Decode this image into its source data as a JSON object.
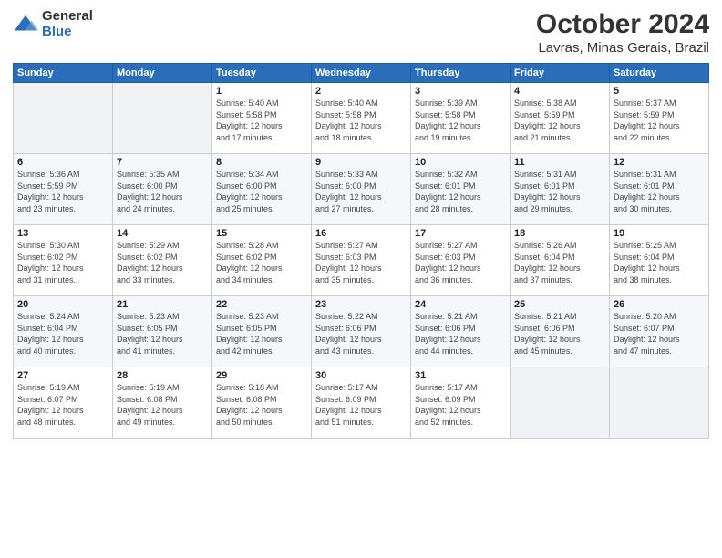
{
  "logo": {
    "general": "General",
    "blue": "Blue"
  },
  "title": "October 2024",
  "location": "Lavras, Minas Gerais, Brazil",
  "weekdays": [
    "Sunday",
    "Monday",
    "Tuesday",
    "Wednesday",
    "Thursday",
    "Friday",
    "Saturday"
  ],
  "weeks": [
    [
      {
        "day": "",
        "info": ""
      },
      {
        "day": "",
        "info": ""
      },
      {
        "day": "1",
        "info": "Sunrise: 5:40 AM\nSunset: 5:58 PM\nDaylight: 12 hours\nand 17 minutes."
      },
      {
        "day": "2",
        "info": "Sunrise: 5:40 AM\nSunset: 5:58 PM\nDaylight: 12 hours\nand 18 minutes."
      },
      {
        "day": "3",
        "info": "Sunrise: 5:39 AM\nSunset: 5:58 PM\nDaylight: 12 hours\nand 19 minutes."
      },
      {
        "day": "4",
        "info": "Sunrise: 5:38 AM\nSunset: 5:59 PM\nDaylight: 12 hours\nand 21 minutes."
      },
      {
        "day": "5",
        "info": "Sunrise: 5:37 AM\nSunset: 5:59 PM\nDaylight: 12 hours\nand 22 minutes."
      }
    ],
    [
      {
        "day": "6",
        "info": "Sunrise: 5:36 AM\nSunset: 5:59 PM\nDaylight: 12 hours\nand 23 minutes."
      },
      {
        "day": "7",
        "info": "Sunrise: 5:35 AM\nSunset: 6:00 PM\nDaylight: 12 hours\nand 24 minutes."
      },
      {
        "day": "8",
        "info": "Sunrise: 5:34 AM\nSunset: 6:00 PM\nDaylight: 12 hours\nand 25 minutes."
      },
      {
        "day": "9",
        "info": "Sunrise: 5:33 AM\nSunset: 6:00 PM\nDaylight: 12 hours\nand 27 minutes."
      },
      {
        "day": "10",
        "info": "Sunrise: 5:32 AM\nSunset: 6:01 PM\nDaylight: 12 hours\nand 28 minutes."
      },
      {
        "day": "11",
        "info": "Sunrise: 5:31 AM\nSunset: 6:01 PM\nDaylight: 12 hours\nand 29 minutes."
      },
      {
        "day": "12",
        "info": "Sunrise: 5:31 AM\nSunset: 6:01 PM\nDaylight: 12 hours\nand 30 minutes."
      }
    ],
    [
      {
        "day": "13",
        "info": "Sunrise: 5:30 AM\nSunset: 6:02 PM\nDaylight: 12 hours\nand 31 minutes."
      },
      {
        "day": "14",
        "info": "Sunrise: 5:29 AM\nSunset: 6:02 PM\nDaylight: 12 hours\nand 33 minutes."
      },
      {
        "day": "15",
        "info": "Sunrise: 5:28 AM\nSunset: 6:02 PM\nDaylight: 12 hours\nand 34 minutes."
      },
      {
        "day": "16",
        "info": "Sunrise: 5:27 AM\nSunset: 6:03 PM\nDaylight: 12 hours\nand 35 minutes."
      },
      {
        "day": "17",
        "info": "Sunrise: 5:27 AM\nSunset: 6:03 PM\nDaylight: 12 hours\nand 36 minutes."
      },
      {
        "day": "18",
        "info": "Sunrise: 5:26 AM\nSunset: 6:04 PM\nDaylight: 12 hours\nand 37 minutes."
      },
      {
        "day": "19",
        "info": "Sunrise: 5:25 AM\nSunset: 6:04 PM\nDaylight: 12 hours\nand 38 minutes."
      }
    ],
    [
      {
        "day": "20",
        "info": "Sunrise: 5:24 AM\nSunset: 6:04 PM\nDaylight: 12 hours\nand 40 minutes."
      },
      {
        "day": "21",
        "info": "Sunrise: 5:23 AM\nSunset: 6:05 PM\nDaylight: 12 hours\nand 41 minutes."
      },
      {
        "day": "22",
        "info": "Sunrise: 5:23 AM\nSunset: 6:05 PM\nDaylight: 12 hours\nand 42 minutes."
      },
      {
        "day": "23",
        "info": "Sunrise: 5:22 AM\nSunset: 6:06 PM\nDaylight: 12 hours\nand 43 minutes."
      },
      {
        "day": "24",
        "info": "Sunrise: 5:21 AM\nSunset: 6:06 PM\nDaylight: 12 hours\nand 44 minutes."
      },
      {
        "day": "25",
        "info": "Sunrise: 5:21 AM\nSunset: 6:06 PM\nDaylight: 12 hours\nand 45 minutes."
      },
      {
        "day": "26",
        "info": "Sunrise: 5:20 AM\nSunset: 6:07 PM\nDaylight: 12 hours\nand 47 minutes."
      }
    ],
    [
      {
        "day": "27",
        "info": "Sunrise: 5:19 AM\nSunset: 6:07 PM\nDaylight: 12 hours\nand 48 minutes."
      },
      {
        "day": "28",
        "info": "Sunrise: 5:19 AM\nSunset: 6:08 PM\nDaylight: 12 hours\nand 49 minutes."
      },
      {
        "day": "29",
        "info": "Sunrise: 5:18 AM\nSunset: 6:08 PM\nDaylight: 12 hours\nand 50 minutes."
      },
      {
        "day": "30",
        "info": "Sunrise: 5:17 AM\nSunset: 6:09 PM\nDaylight: 12 hours\nand 51 minutes."
      },
      {
        "day": "31",
        "info": "Sunrise: 5:17 AM\nSunset: 6:09 PM\nDaylight: 12 hours\nand 52 minutes."
      },
      {
        "day": "",
        "info": ""
      },
      {
        "day": "",
        "info": ""
      }
    ]
  ]
}
